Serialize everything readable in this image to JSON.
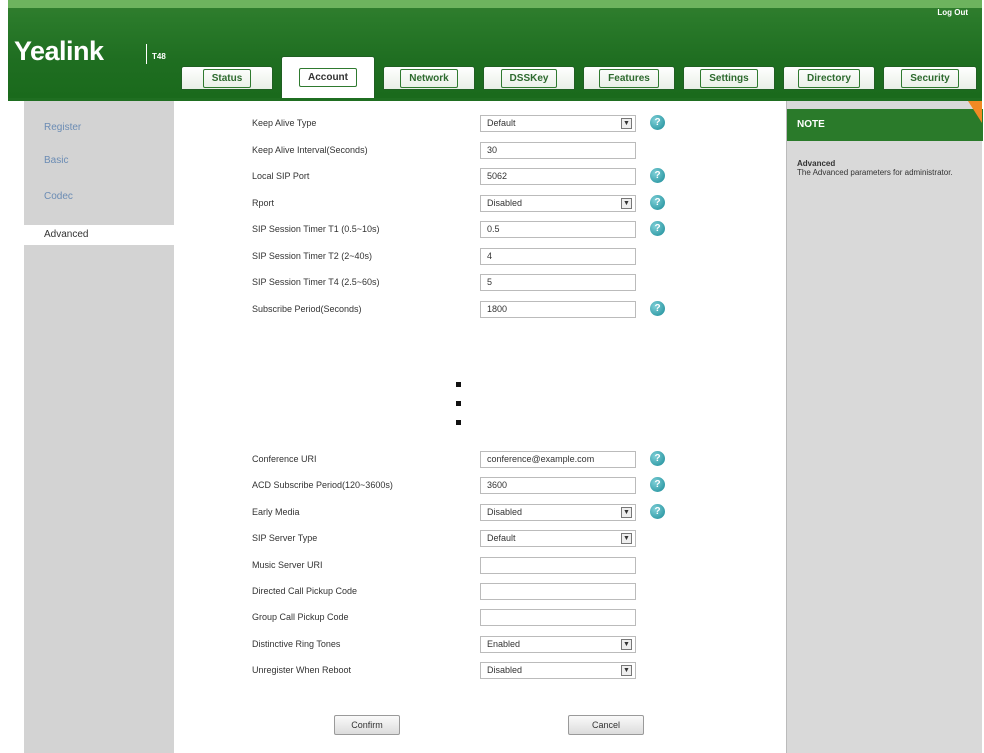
{
  "header": {
    "logout": "Log Out",
    "brand": "Yealink",
    "model": "T48"
  },
  "tabs": [
    {
      "label": "Status",
      "active": false
    },
    {
      "label": "Account",
      "active": true
    },
    {
      "label": "Network",
      "active": false
    },
    {
      "label": "DSSKey",
      "active": false
    },
    {
      "label": "Features",
      "active": false
    },
    {
      "label": "Settings",
      "active": false
    },
    {
      "label": "Directory",
      "active": false
    },
    {
      "label": "Security",
      "active": false
    }
  ],
  "sidebar": {
    "items": [
      {
        "label": "Register",
        "active": false
      },
      {
        "label": "Basic",
        "active": false
      },
      {
        "label": "Codec",
        "active": false
      },
      {
        "label": "Advanced",
        "active": true
      }
    ]
  },
  "form_top": [
    {
      "label": "Keep Alive Type",
      "value": "Default",
      "kind": "select",
      "help": true
    },
    {
      "label": "Keep Alive Interval(Seconds)",
      "value": "30",
      "kind": "input",
      "help": false
    },
    {
      "label": "Local SIP Port",
      "value": "5062",
      "kind": "input",
      "help": true
    },
    {
      "label": "Rport",
      "value": "Disabled",
      "kind": "select",
      "help": true
    },
    {
      "label": "SIP Session Timer T1 (0.5~10s)",
      "value": "0.5",
      "kind": "input",
      "help": true
    },
    {
      "label": "SIP Session Timer T2 (2~40s)",
      "value": "4",
      "kind": "input",
      "help": false
    },
    {
      "label": "SIP Session Timer T4 (2.5~60s)",
      "value": "5",
      "kind": "input",
      "help": false
    },
    {
      "label": "Subscribe Period(Seconds)",
      "value": "1800",
      "kind": "input",
      "help": true
    }
  ],
  "form_bottom": [
    {
      "label": "Conference URI",
      "value": "conference@example.com",
      "kind": "input",
      "help": true
    },
    {
      "label": "ACD Subscribe Period(120~3600s)",
      "value": "3600",
      "kind": "input",
      "help": true
    },
    {
      "label": "Early Media",
      "value": "Disabled",
      "kind": "select",
      "help": true
    },
    {
      "label": "SIP Server Type",
      "value": "Default",
      "kind": "select",
      "help": false
    },
    {
      "label": "Music Server URI",
      "value": "",
      "kind": "input",
      "help": false
    },
    {
      "label": "Directed Call Pickup Code",
      "value": "",
      "kind": "input",
      "help": false
    },
    {
      "label": "Group Call Pickup Code",
      "value": "",
      "kind": "input",
      "help": false
    },
    {
      "label": "Distinctive Ring Tones",
      "value": "Enabled",
      "kind": "select",
      "help": false
    },
    {
      "label": "Unregister When Reboot",
      "value": "Disabled",
      "kind": "select",
      "help": false
    }
  ],
  "buttons": {
    "confirm": "Confirm",
    "cancel": "Cancel"
  },
  "note": {
    "heading": "NOTE",
    "title": "Advanced",
    "description": "The Advanced parameters for administrator."
  },
  "icons": {
    "help": "help-icon",
    "dropdown": "dropdown-arrow-icon"
  },
  "colors": {
    "header_green": "#2a7a2a",
    "sidebar_gray": "#d3d3d3",
    "link_blue": "#6b8cb4",
    "help_teal": "#188a96",
    "note_corner": "#f08a24"
  }
}
